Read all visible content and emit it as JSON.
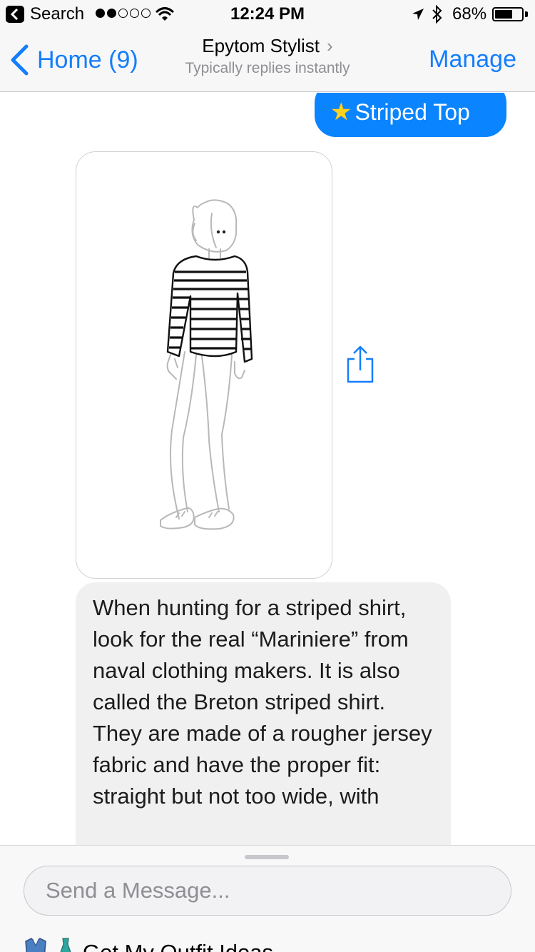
{
  "status_bar": {
    "back_app": "Search",
    "time": "12:24 PM",
    "battery_percent": "68%",
    "battery_level": 0.68,
    "signal_bars_filled": 2,
    "signal_bars_total": 5
  },
  "nav": {
    "back_label": "Home (9)",
    "title": "Epytom Stylist",
    "subtitle": "Typically replies instantly",
    "action_label": "Manage"
  },
  "messages": {
    "outgoing_text": "Striped Top",
    "incoming_text": "When hunting for a striped shirt, look for the real “Mariniere” from naval clothing makers. It is also called the Breton striped shirt. They are made of a rougher jersey fabric and have the proper fit: straight but not too wide, with"
  },
  "composer": {
    "placeholder": "Send a Message...",
    "quick_reply_label": "Get My Outfit Ideas"
  },
  "colors": {
    "accent": "#147efb",
    "outgoing_bubble": "#0a84ff",
    "incoming_bubble": "#f0f0f0"
  },
  "icons": {
    "outgoing_emoji": "star-icon",
    "share": "share-icon",
    "quick_reply": "outfit-icons"
  }
}
